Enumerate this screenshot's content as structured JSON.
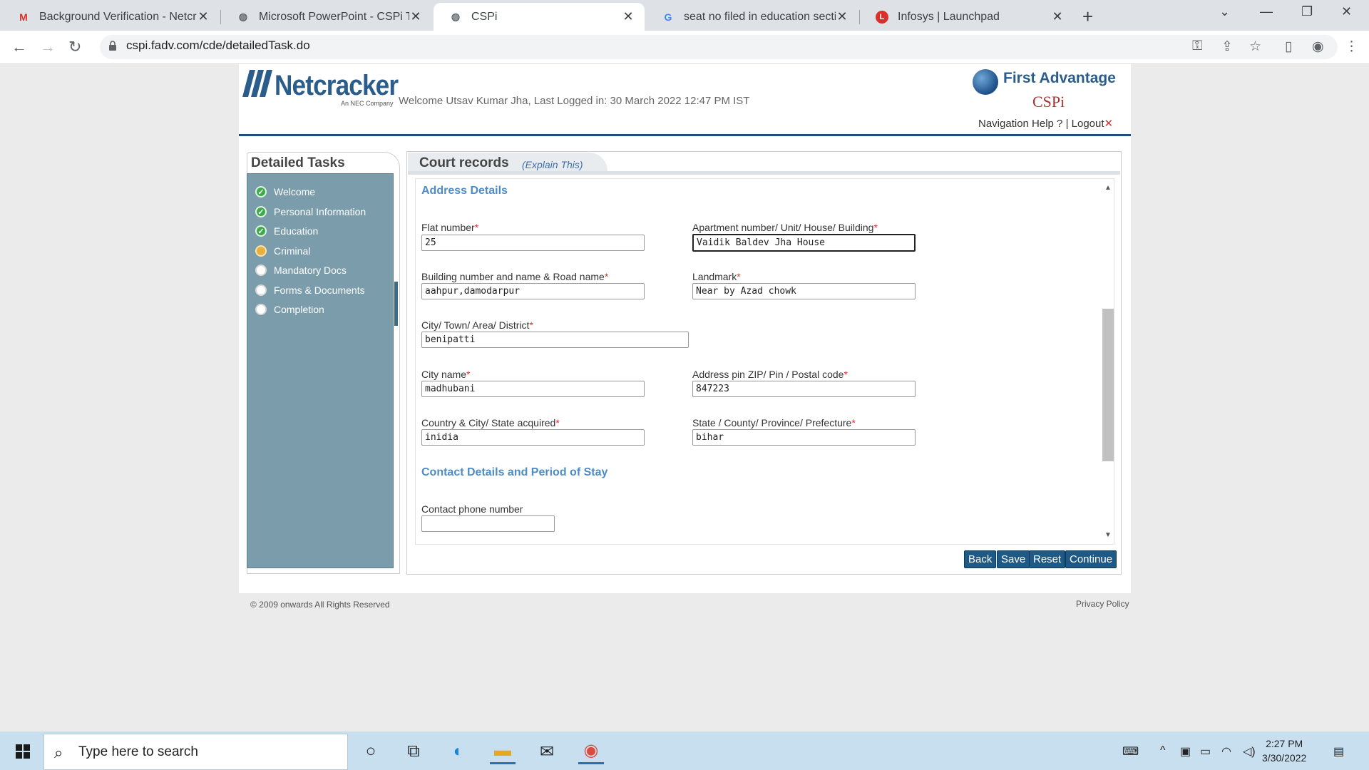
{
  "browser": {
    "tabs": [
      {
        "title": "Background Verification - Netcra",
        "favicon": "gmail-icon"
      },
      {
        "title": "Microsoft PowerPoint - CSPi Trai",
        "favicon": "globe-icon"
      },
      {
        "title": "CSPi",
        "favicon": "globe-icon"
      },
      {
        "title": "seat no filed in education section",
        "favicon": "google-icon"
      },
      {
        "title": "Infosys | Launchpad",
        "favicon": "launchpad-icon"
      }
    ],
    "url": "cspi.fadv.com/cde/detailedTask.do"
  },
  "header": {
    "logo": "Netcracker",
    "logo_sub": "An NEC Company",
    "welcome": "Welcome Utsav Kumar Jha, Last Logged in: 30 March 2022 12:47 PM IST",
    "fa_brand": "First Advantage",
    "csp_brand": "CSPi",
    "nav_help": "Navigation Help ?",
    "logout": "Logout"
  },
  "sidebar": {
    "title": "Detailed Tasks",
    "items": [
      {
        "label": "Welcome",
        "status": "done"
      },
      {
        "label": "Personal Information",
        "status": "done"
      },
      {
        "label": "Education",
        "status": "done"
      },
      {
        "label": "Criminal",
        "status": "current"
      },
      {
        "label": "Mandatory Docs",
        "status": "todo"
      },
      {
        "label": "Forms & Documents",
        "status": "todo"
      },
      {
        "label": "Completion",
        "status": "todo"
      }
    ]
  },
  "main": {
    "title": "Court records",
    "explain": "(Explain This)",
    "address_section": "Address Details",
    "contact_section": "Contact Details and Period of Stay",
    "fields": {
      "flat": {
        "label": "Flat number",
        "value": "25"
      },
      "apartment": {
        "label": "Apartment number/ Unit/ House/ Building",
        "value": "Vaidik Baldev Jha  House"
      },
      "building": {
        "label": "Building number and name & Road name",
        "value": "aahpur,damodarpur"
      },
      "landmark": {
        "label": "Landmark",
        "value": "Near by Azad chowk"
      },
      "city_town": {
        "label": "City/ Town/ Area/ District",
        "value": "benipatti"
      },
      "city_name": {
        "label": "City name",
        "value": "madhubani"
      },
      "pin": {
        "label": "Address pin ZIP/ Pin / Postal code",
        "value": "847223"
      },
      "country": {
        "label": "Country & City/ State acquired",
        "value": "inidia"
      },
      "state": {
        "label": "State / County/ Province/ Prefecture",
        "value": "bihar"
      },
      "phone": {
        "label": "Contact phone number",
        "value": ""
      }
    },
    "buttons": {
      "back": "Back",
      "save": "Save",
      "reset": "Reset",
      "continue": "Continue"
    }
  },
  "footer": {
    "copyright": "© 2009 onwards All Rights Reserved",
    "privacy": "Privacy Policy"
  },
  "taskbar": {
    "search_placeholder": "Type here to search",
    "time": "2:27 PM",
    "date": "3/30/2022"
  }
}
